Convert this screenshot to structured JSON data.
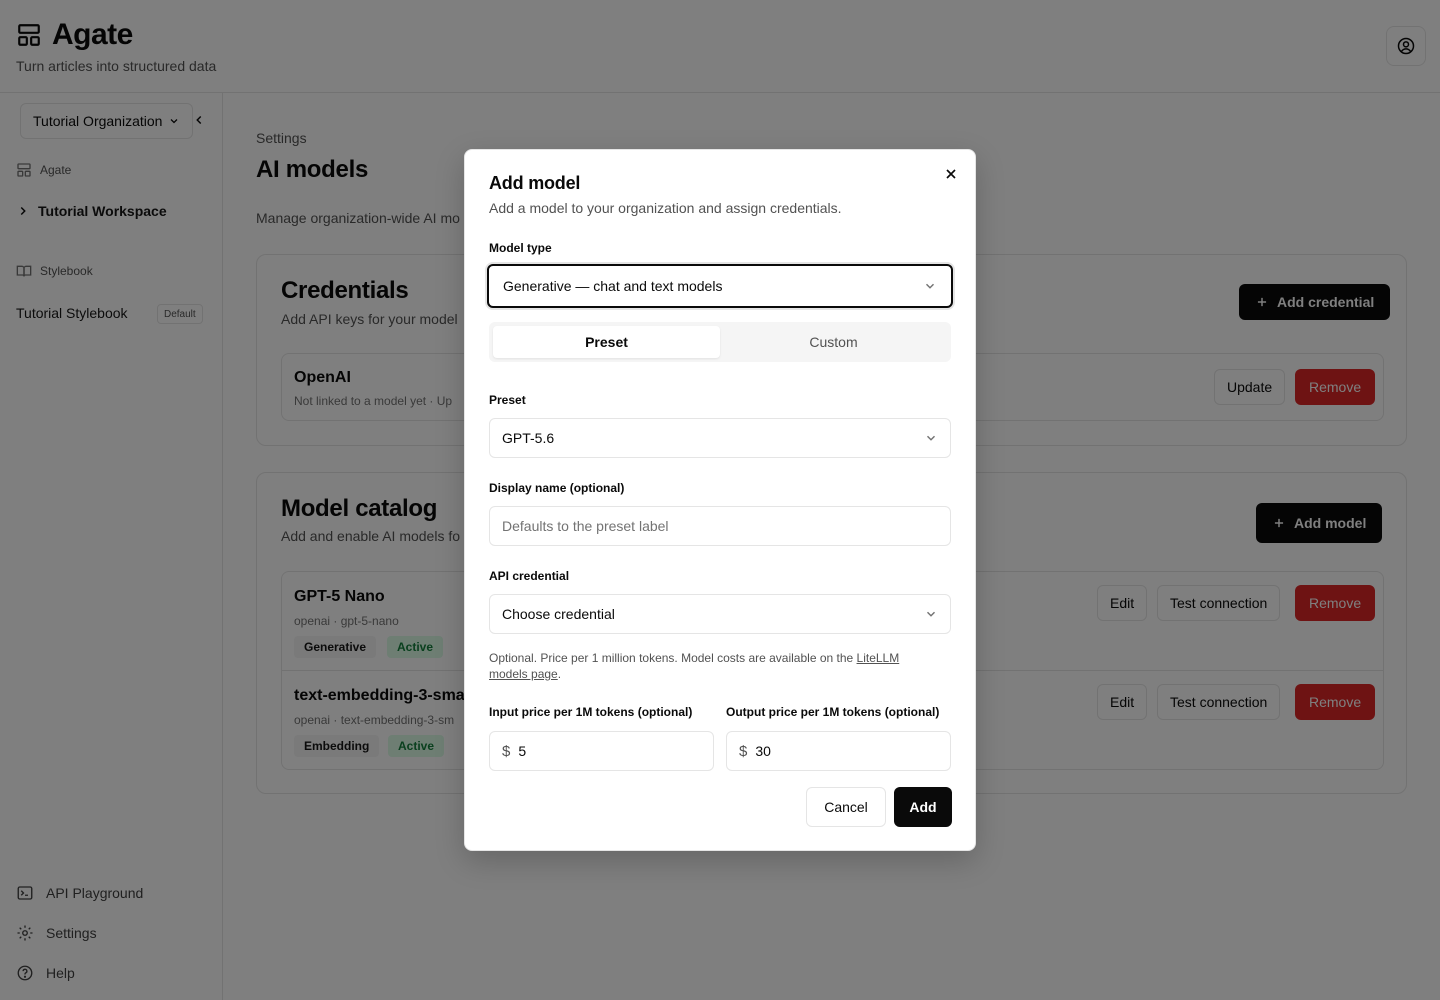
{
  "header": {
    "app_name": "Agate",
    "tagline": "Turn articles into structured data",
    "logo_icon": "layout-grid-icon",
    "account_icon": "user-circle-icon"
  },
  "sidebar": {
    "org_select": "Tutorial Organization",
    "section_agate": "Agate",
    "workspace": "Tutorial Workspace",
    "section_stylebook": "Stylebook",
    "stylebook_item": "Tutorial Stylebook",
    "default_badge": "Default",
    "footer": [
      {
        "label": "API Playground",
        "icon": "terminal-icon"
      },
      {
        "label": "Settings",
        "icon": "gear-icon"
      },
      {
        "label": "Help",
        "icon": "help-circle-icon"
      }
    ]
  },
  "page": {
    "breadcrumb": "Settings",
    "title": "AI models",
    "description": "Manage organization-wide AI mo"
  },
  "credentials": {
    "title": "Credentials",
    "description": "Add API keys for your model",
    "add_button": "Add credential",
    "items": [
      {
        "name": "OpenAI",
        "sub": "Not linked to a model yet · Up",
        "update": "Update",
        "remove": "Remove"
      }
    ]
  },
  "catalog": {
    "title": "Model catalog",
    "description": "Add and enable AI models fo",
    "add_button": "Add model",
    "items": [
      {
        "name": "GPT-5 Nano",
        "sub": "openai · gpt-5-nano",
        "type_badge": "Generative",
        "status_badge": "Active",
        "edit": "Edit",
        "test": "Test connection",
        "remove": "Remove"
      },
      {
        "name": "text-embedding-3-sma",
        "sub": "openai · text-embedding-3-sm",
        "type_badge": "Embedding",
        "status_badge": "Active",
        "edit": "Edit",
        "test": "Test connection",
        "remove": "Remove"
      }
    ]
  },
  "dialog": {
    "title": "Add model",
    "description": "Add a model to your organization and assign credentials.",
    "model_type_label": "Model type",
    "model_type_value": "Generative — chat and text models",
    "tabs": [
      "Preset",
      "Custom"
    ],
    "active_tab": "Preset",
    "preset_label": "Preset",
    "preset_value": "GPT-5.6",
    "display_name_label": "Display name (optional)",
    "display_name_placeholder": "Defaults to the preset label",
    "credential_label": "API credential",
    "credential_value": "Choose credential",
    "hint_text": "Optional. Price per 1 million tokens. Model costs are available on the ",
    "hint_link": "LiteLLM models page",
    "hint_end": ".",
    "input_price_label": "Input price per 1M tokens (optional)",
    "input_price_currency": "$",
    "input_price_value": "5",
    "output_price_label": "Output price per 1M tokens (optional)",
    "output_price_currency": "$",
    "output_price_value": "30",
    "cancel": "Cancel",
    "add": "Add"
  },
  "colors": {
    "primary": "#0a0a0a",
    "danger": "#dc2626",
    "border": "#e5e5e5",
    "muted_text": "#525252",
    "success_bg": "#dcfce7",
    "success_text": "#15803d"
  }
}
